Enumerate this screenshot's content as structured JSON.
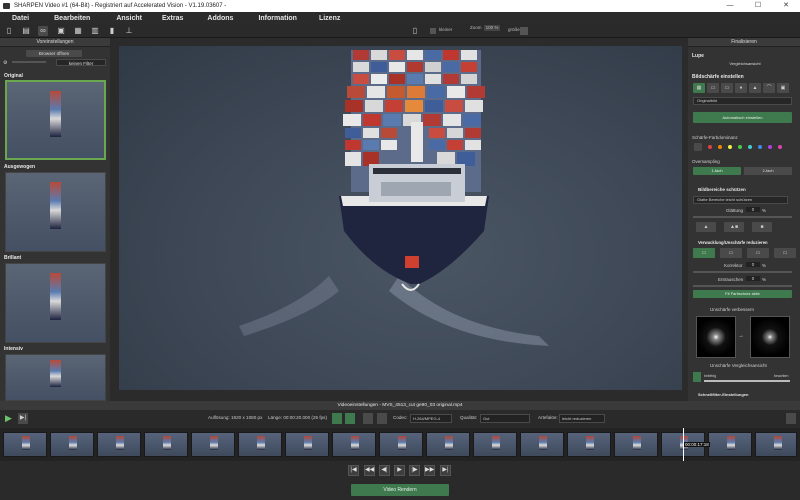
{
  "window": {
    "title": "SHARPEN Video #1 (64-Bit) - Registriert auf Accelerated Vision - V1.19.03607 -",
    "minimize": "—",
    "maximize": "☐",
    "close": "✕"
  },
  "menu": [
    "Datei",
    "Bearbeiten",
    "Ansicht",
    "Extras",
    "Addons",
    "Information",
    "Lizenz"
  ],
  "toolbar": {
    "zoom_label": "Zoom",
    "zoom_value": "100 %",
    "smaller": "kleiner",
    "larger": "größer"
  },
  "left_panel": {
    "title": "Voreinstellungen",
    "browse_button": "Browser öffnen",
    "filter_select": "keinen Filter",
    "presets": [
      "Original",
      "Ausgewogen",
      "Brillant",
      "Intensiv"
    ]
  },
  "right_panel": {
    "title": "Finalisieren",
    "loupe": "Lupe",
    "compare_button": "Vergleichsansicht",
    "sharpen_heading": "Bildschärfe einstellen",
    "original_select": "Originalbild",
    "auto_button": "Automatisch einstellen",
    "colors_label": "Schärfe-Farbdominanz",
    "oversampling_label": "Oversampling",
    "oversampling_1x": "1-fach",
    "oversampling_2x": "2-fach",
    "protect_heading": "Bildbereiche schützen",
    "protect_select": "Glatte Bereiche leicht schützen",
    "smoothing_label": "Glättung",
    "smoothing_value": "0",
    "smoothing_unit": "%",
    "blur_heading": "Verwacklung/Unschärfe reduzieren",
    "corrector_label": "Korrektor",
    "corrector_value": "0",
    "corrector_unit": "%",
    "radius_label": "Entrauschen",
    "radius_value": "0",
    "radius_unit": "%",
    "fit_button": "Fit Farbschutz aktiv",
    "blur_types": "Unschärfe verbessern",
    "blur_compare": "Unschärfe Vergleichsansicht",
    "slider_left": "beliebig",
    "slider_right": "beachten",
    "extra_heading": "Schnellfilter-Einstellungen"
  },
  "video_bar": {
    "text": "Videoeinstellungen - MVS_4513_cut ge90_03 original.mp4"
  },
  "controls": {
    "resolution": "Auflösung: 1920 x 1080 px",
    "length": "Länge: 00:00:20.000 (25 fps)",
    "codec_label": "Codec:",
    "codec_value": "H.264/MPEG-4",
    "quality_label": "Qualität:",
    "quality_value": "Gut",
    "artifacts_label": "Artefakte:",
    "artifacts_value": "leicht reduzieren"
  },
  "filmstrip": {
    "timestamp": "00:00:17:18",
    "frames": 17
  },
  "nav": {
    "buttons": [
      "|◀",
      "◀◀",
      "◀|",
      "▶",
      "|▶",
      "▶▶",
      "▶|"
    ],
    "save_label": "Video Rendern"
  },
  "colors": {
    "accent_green": "#3f7a4f",
    "selection_green": "#6aa84f",
    "background": "#2d2d2d"
  }
}
